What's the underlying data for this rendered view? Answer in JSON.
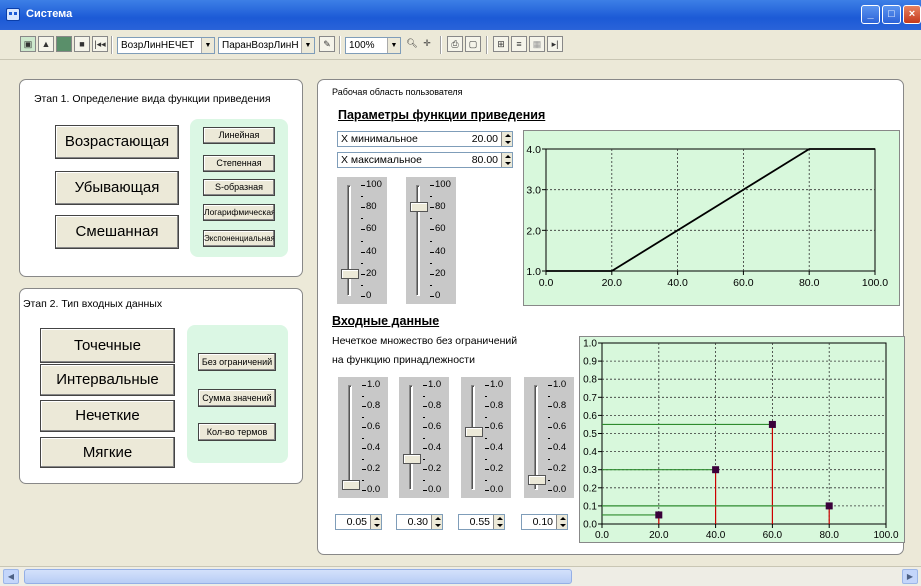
{
  "window": {
    "title": "Система"
  },
  "toolbar": {
    "combo1": "ВозрЛинНЕЧЕТ",
    "combo2": "ПаранВозрЛинН",
    "zoom": "100%"
  },
  "stage1": {
    "title": "Этап 1. Определение вида функции приведения",
    "types": [
      "Возрастающая",
      "Убывающая",
      "Смешанная"
    ],
    "forms": [
      "Линейная",
      "Степенная",
      "S-образная",
      "Логарифмическая",
      "Экспоненциальная"
    ]
  },
  "stage2": {
    "title": "Этап 2. Тип входных данных",
    "types": [
      "Точечные значения",
      "Интервальные",
      "Нечеткие",
      "Мягкие"
    ],
    "options": [
      "Без ограничений",
      "Сумма значений",
      "Кол-во термов"
    ]
  },
  "workspace": {
    "title": "Рабочая область пользователя",
    "params_heading": "Параметры функции приведения",
    "x_min_label": "X минимальное",
    "x_min_value": "20.00",
    "x_max_label": "X максимальное",
    "x_max_value": "80.00",
    "slider_scale_100": [
      "100",
      "80",
      "60",
      "40",
      "20",
      "0"
    ],
    "slider_levels_100": [
      20,
      80
    ],
    "input_heading": "Входные данные",
    "input_desc_line1": "Нечеткое множество без ограничений",
    "input_desc_line2": "на функцию принадлежности",
    "slider_scale_1": [
      "1.0",
      "0.8",
      "0.6",
      "0.4",
      "0.2",
      "0.0"
    ],
    "input_values": [
      "0.05",
      "0.30",
      "0.55",
      "0.10"
    ]
  },
  "chart_data": [
    {
      "type": "line",
      "x": [
        0,
        20,
        80,
        100
      ],
      "y": [
        1,
        1,
        4,
        4
      ],
      "xlim": [
        0,
        100
      ],
      "ylim": [
        1,
        4
      ],
      "xticks": [
        "0.0",
        "20.0",
        "40.0",
        "60.0",
        "80.0",
        "100.0"
      ],
      "yticks": [
        "1.0",
        "2.0",
        "3.0",
        "4.0"
      ],
      "grid": true,
      "colors": {
        "background": "#d8f8dc",
        "line": "#000000"
      }
    },
    {
      "type": "scatter",
      "x": [
        20,
        40,
        60,
        80
      ],
      "y": [
        0.05,
        0.3,
        0.55,
        0.1
      ],
      "xlim": [
        0,
        100
      ],
      "ylim": [
        0,
        1
      ],
      "xticks": [
        "0.0",
        "20.0",
        "40.0",
        "60.0",
        "80.0",
        "100.0"
      ],
      "yticks": [
        "0.0",
        "0.1",
        "0.2",
        "0.3",
        "0.4",
        "0.5",
        "0.6",
        "0.7",
        "0.8",
        "0.9",
        "1.0"
      ],
      "grid": true,
      "colors": {
        "background": "#d8f8dc",
        "vline": "#cc0000",
        "hline": "#2e8b2e",
        "marker": "#3a003a"
      }
    }
  ]
}
